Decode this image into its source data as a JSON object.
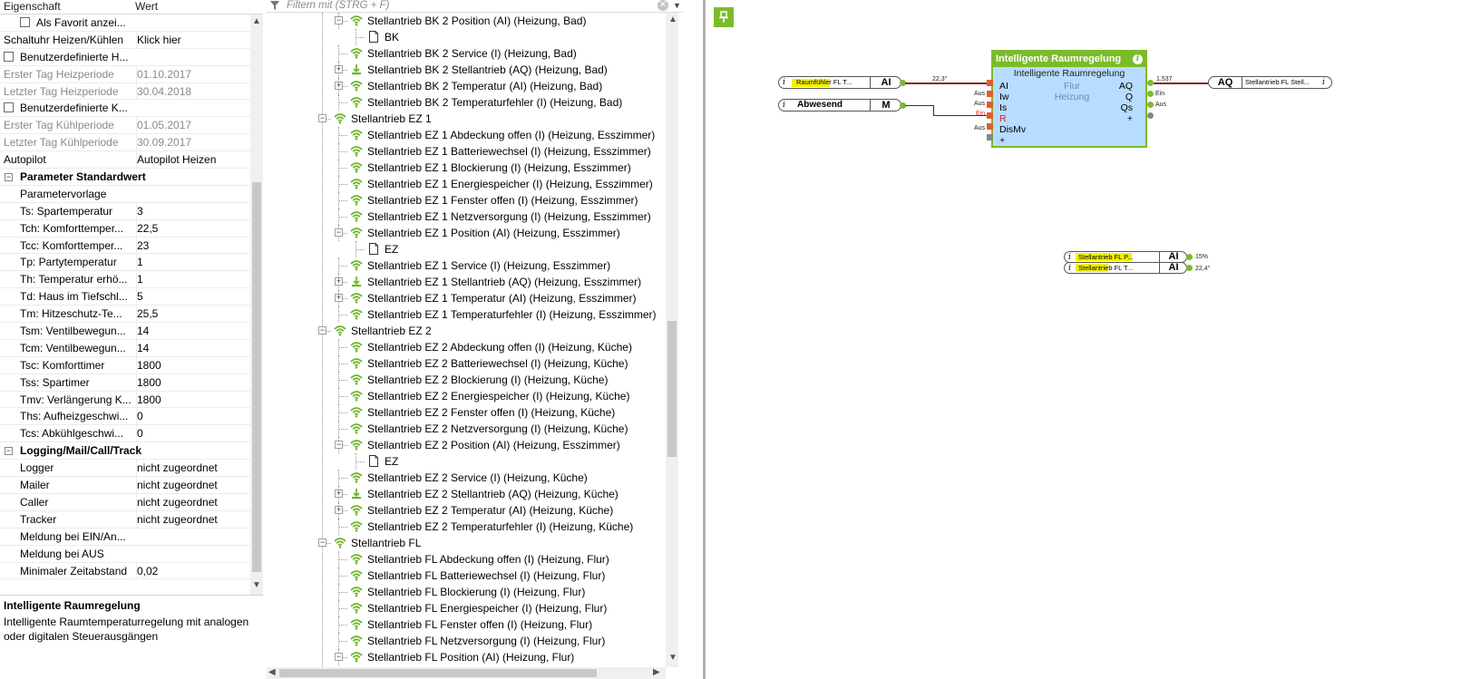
{
  "properties": {
    "header": {
      "col_property": "Eigenschaft",
      "col_value": "Wert"
    },
    "rows": [
      {
        "type": "check",
        "key": "Als Favorit anzei...",
        "value": "",
        "indent": true
      },
      {
        "type": "row",
        "key": "Schaltuhr Heizen/Kühlen",
        "value": "Klick hier"
      },
      {
        "type": "check",
        "key": "Benutzerdefinierte H...",
        "value": ""
      },
      {
        "type": "row",
        "key": "Erster Tag Heizperiode",
        "value": "01.10.2017",
        "gray": true
      },
      {
        "type": "row",
        "key": "Letzter Tag Heizperiode",
        "value": "30.04.2018",
        "gray": true
      },
      {
        "type": "check",
        "key": "Benutzerdefinierte K...",
        "value": ""
      },
      {
        "type": "row",
        "key": "Erster Tag Kühlperiode",
        "value": "01.05.2017",
        "gray": true
      },
      {
        "type": "row",
        "key": "Letzter Tag Kühlperiode",
        "value": "30.09.2017",
        "gray": true
      },
      {
        "type": "row",
        "key": "Autopilot",
        "value": "Autopilot Heizen"
      },
      {
        "type": "cat",
        "key": "Parameter Standardwert",
        "value": ""
      },
      {
        "type": "row",
        "key": "Parametervorlage",
        "value": "",
        "indent": true
      },
      {
        "type": "row",
        "key": "Ts: Spartemperatur",
        "value": "3",
        "indent": true
      },
      {
        "type": "row",
        "key": "Tch: Komforttemper...",
        "value": "22,5",
        "indent": true
      },
      {
        "type": "row",
        "key": "Tcc: Komforttemper...",
        "value": "23",
        "indent": true
      },
      {
        "type": "row",
        "key": "Tp: Partytemperatur",
        "value": "1",
        "indent": true
      },
      {
        "type": "row",
        "key": "Th: Temperatur erhö...",
        "value": "1",
        "indent": true
      },
      {
        "type": "row",
        "key": "Td: Haus im Tiefschl...",
        "value": "5",
        "indent": true
      },
      {
        "type": "row",
        "key": "Tm: Hitzeschutz-Te...",
        "value": "25,5",
        "indent": true
      },
      {
        "type": "row",
        "key": "Tsm: Ventilbewegun...",
        "value": "14",
        "indent": true
      },
      {
        "type": "row",
        "key": "Tcm: Ventilbewegun...",
        "value": "14",
        "indent": true
      },
      {
        "type": "row",
        "key": "Tsc: Komforttimer",
        "value": "1800",
        "indent": true
      },
      {
        "type": "row",
        "key": "Tss: Spartimer",
        "value": "1800",
        "indent": true
      },
      {
        "type": "row",
        "key": "Tmv: Verlängerung K...",
        "value": "1800",
        "indent": true
      },
      {
        "type": "row",
        "key": "Ths: Aufheizgeschwi...",
        "value": "0",
        "indent": true
      },
      {
        "type": "row",
        "key": "Tcs: Abkühlgeschwi...",
        "value": "0",
        "indent": true
      },
      {
        "type": "cat",
        "key": "Logging/Mail/Call/Track",
        "value": ""
      },
      {
        "type": "row",
        "key": "Logger",
        "value": "nicht zugeordnet",
        "indent": true
      },
      {
        "type": "row",
        "key": "Mailer",
        "value": "nicht zugeordnet",
        "indent": true
      },
      {
        "type": "row",
        "key": "Caller",
        "value": "nicht zugeordnet",
        "indent": true
      },
      {
        "type": "row",
        "key": "Tracker",
        "value": "nicht zugeordnet",
        "indent": true
      },
      {
        "type": "row",
        "key": "Meldung bei EIN/An...",
        "value": "",
        "indent": true
      },
      {
        "type": "row",
        "key": "Meldung bei AUS",
        "value": "",
        "indent": true
      },
      {
        "type": "row",
        "key": "Minimaler Zeitabstand",
        "value": "0,02",
        "indent": true
      }
    ]
  },
  "description": {
    "title": "Intelligente Raumregelung",
    "text": "Intelligente Raumtemperaturregelung mit analogen oder digitalen Steuerausgängen"
  },
  "tree": {
    "filter_placeholder": "Filtern mit (STRG + F)",
    "rows": [
      {
        "level": 2,
        "icon": "wifi",
        "exp": "minus",
        "label": "Stellantrieb BK 2 Position (AI) (Heizung, Bad)"
      },
      {
        "level": 3,
        "icon": "page",
        "exp": "",
        "label": "BK"
      },
      {
        "level": 2,
        "icon": "wifi",
        "exp": "",
        "label": "Stellantrieb BK 2 Service (I) (Heizung, Bad)"
      },
      {
        "level": 2,
        "icon": "actuator",
        "exp": "plus",
        "label": "Stellantrieb BK 2 Stellantrieb (AQ) (Heizung, Bad)"
      },
      {
        "level": 2,
        "icon": "wifi",
        "exp": "plus",
        "label": "Stellantrieb BK 2 Temperatur (AI) (Heizung, Bad)"
      },
      {
        "level": 2,
        "icon": "wifi",
        "exp": "",
        "label": "Stellantrieb BK 2 Temperaturfehler (I) (Heizung, Bad)"
      },
      {
        "level": 1,
        "icon": "wifi",
        "exp": "minus",
        "label": "Stellantrieb EZ 1"
      },
      {
        "level": 2,
        "icon": "wifi",
        "exp": "",
        "label": "Stellantrieb EZ 1 Abdeckung offen (I) (Heizung, Esszimmer)"
      },
      {
        "level": 2,
        "icon": "wifi",
        "exp": "",
        "label": "Stellantrieb EZ 1 Batteriewechsel (I) (Heizung, Esszimmer)"
      },
      {
        "level": 2,
        "icon": "wifi",
        "exp": "",
        "label": "Stellantrieb EZ 1 Blockierung (I) (Heizung, Esszimmer)"
      },
      {
        "level": 2,
        "icon": "wifi",
        "exp": "",
        "label": "Stellantrieb EZ 1 Energiespeicher (I) (Heizung, Esszimmer)"
      },
      {
        "level": 2,
        "icon": "wifi",
        "exp": "",
        "label": "Stellantrieb EZ 1 Fenster offen (I) (Heizung, Esszimmer)"
      },
      {
        "level": 2,
        "icon": "wifi",
        "exp": "",
        "label": "Stellantrieb EZ 1 Netzversorgung (I) (Heizung, Esszimmer)"
      },
      {
        "level": 2,
        "icon": "wifi",
        "exp": "minus",
        "label": "Stellantrieb EZ 1 Position (AI) (Heizung, Esszimmer)"
      },
      {
        "level": 3,
        "icon": "page",
        "exp": "",
        "label": "EZ"
      },
      {
        "level": 2,
        "icon": "wifi",
        "exp": "",
        "label": "Stellantrieb EZ 1 Service (I) (Heizung, Esszimmer)"
      },
      {
        "level": 2,
        "icon": "actuator",
        "exp": "plus",
        "label": "Stellantrieb EZ 1 Stellantrieb (AQ) (Heizung, Esszimmer)"
      },
      {
        "level": 2,
        "icon": "wifi",
        "exp": "plus",
        "label": "Stellantrieb EZ 1 Temperatur (AI) (Heizung, Esszimmer)"
      },
      {
        "level": 2,
        "icon": "wifi",
        "exp": "",
        "label": "Stellantrieb EZ 1 Temperaturfehler (I) (Heizung, Esszimmer)"
      },
      {
        "level": 1,
        "icon": "wifi",
        "exp": "minus",
        "label": "Stellantrieb EZ 2"
      },
      {
        "level": 2,
        "icon": "wifi",
        "exp": "",
        "label": "Stellantrieb EZ 2 Abdeckung offen (I) (Heizung, Küche)"
      },
      {
        "level": 2,
        "icon": "wifi",
        "exp": "",
        "label": "Stellantrieb EZ 2 Batteriewechsel (I) (Heizung, Küche)"
      },
      {
        "level": 2,
        "icon": "wifi",
        "exp": "",
        "label": "Stellantrieb EZ 2 Blockierung (I) (Heizung, Küche)"
      },
      {
        "level": 2,
        "icon": "wifi",
        "exp": "",
        "label": "Stellantrieb EZ 2 Energiespeicher (I) (Heizung, Küche)"
      },
      {
        "level": 2,
        "icon": "wifi",
        "exp": "",
        "label": "Stellantrieb EZ 2 Fenster offen (I) (Heizung, Küche)"
      },
      {
        "level": 2,
        "icon": "wifi",
        "exp": "",
        "label": "Stellantrieb EZ 2 Netzversorgung (I) (Heizung, Küche)"
      },
      {
        "level": 2,
        "icon": "wifi",
        "exp": "minus",
        "label": "Stellantrieb EZ 2 Position (AI) (Heizung, Esszimmer)"
      },
      {
        "level": 3,
        "icon": "page",
        "exp": "",
        "label": "EZ"
      },
      {
        "level": 2,
        "icon": "wifi",
        "exp": "",
        "label": "Stellantrieb EZ 2 Service (I) (Heizung, Küche)"
      },
      {
        "level": 2,
        "icon": "actuator",
        "exp": "plus",
        "label": "Stellantrieb EZ 2 Stellantrieb (AQ) (Heizung, Küche)"
      },
      {
        "level": 2,
        "icon": "wifi",
        "exp": "plus",
        "label": "Stellantrieb EZ 2 Temperatur (AI) (Heizung, Küche)"
      },
      {
        "level": 2,
        "icon": "wifi",
        "exp": "",
        "label": "Stellantrieb EZ 2 Temperaturfehler (I) (Heizung, Küche)"
      },
      {
        "level": 1,
        "icon": "wifi",
        "exp": "minus",
        "label": "Stellantrieb FL"
      },
      {
        "level": 2,
        "icon": "wifi",
        "exp": "",
        "label": "Stellantrieb FL Abdeckung offen (I) (Heizung, Flur)"
      },
      {
        "level": 2,
        "icon": "wifi",
        "exp": "",
        "label": "Stellantrieb FL Batteriewechsel (I) (Heizung, Flur)"
      },
      {
        "level": 2,
        "icon": "wifi",
        "exp": "",
        "label": "Stellantrieb FL Blockierung (I) (Heizung, Flur)"
      },
      {
        "level": 2,
        "icon": "wifi",
        "exp": "",
        "label": "Stellantrieb FL Energiespeicher (I) (Heizung, Flur)"
      },
      {
        "level": 2,
        "icon": "wifi",
        "exp": "",
        "label": "Stellantrieb FL Fenster offen (I) (Heizung, Flur)"
      },
      {
        "level": 2,
        "icon": "wifi",
        "exp": "",
        "label": "Stellantrieb FL Netzversorgung (I) (Heizung, Flur)"
      },
      {
        "level": 2,
        "icon": "wifi",
        "exp": "minus",
        "label": "Stellantrieb FL Position (AI) (Heizung, Flur)"
      }
    ]
  },
  "canvas": {
    "accent_color": "#7bbb2b",
    "block": {
      "title": "Intelligente Raumregelung",
      "subtitle": "Intelligente Raumregelung",
      "room": "Flur",
      "mode": "Heizung",
      "inputs": [
        "AI",
        "Iw",
        "Is",
        "R",
        "DisMv",
        "+"
      ],
      "outputs": [
        "AQ",
        "Q",
        "Qs",
        "+"
      ]
    },
    "in_ai": {
      "name": "Raumfühler FL T...",
      "type": "AI",
      "value": "22,3°"
    },
    "in_m": {
      "name": "Abwesend",
      "type": "M"
    },
    "input_states": {
      "iw": "Aus",
      "is": "Aus",
      "r": "Ein",
      "dismv": "Aus"
    },
    "out_aq": {
      "name": "Stellantrieb FL Stell...",
      "type": "AQ",
      "value": "1,537"
    },
    "output_states": {
      "q": "Ein",
      "qs": "Aus"
    },
    "mon1": {
      "name": "Stellantrieb FL P...",
      "type": "AI",
      "value": "15%"
    },
    "mon2": {
      "name": "Stellantrieb FL T...",
      "type": "AI",
      "value": "22,4°"
    }
  }
}
